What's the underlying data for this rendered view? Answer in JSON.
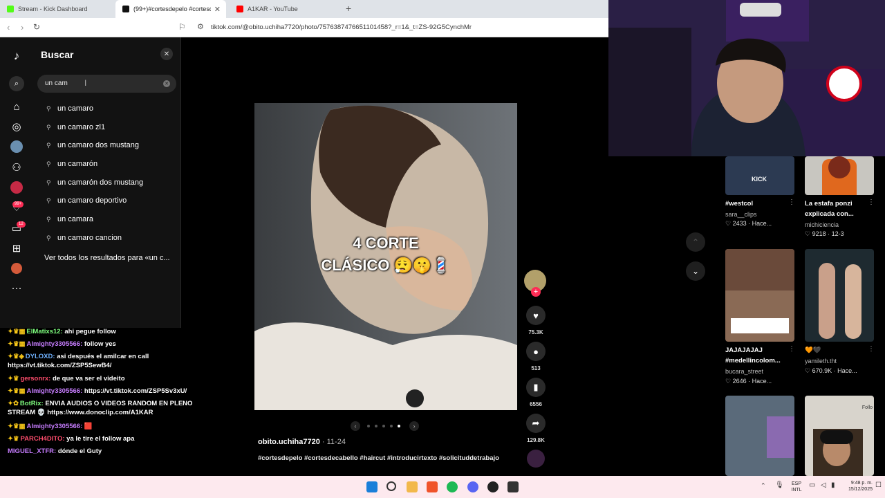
{
  "browser": {
    "tabs": [
      {
        "title": "Stream - Kick Dashboard"
      },
      {
        "title": "(99+)#cortesdepelo #cortesdec..."
      },
      {
        "title": "A1KAR - YouTube"
      }
    ],
    "url": "tiktok.com/@obito.uchiha7720/photo/7576387476651101458?_r=1&_t=ZS-92G5CynchMr"
  },
  "sidebar": {
    "rail_icons": [
      "tiktok-logo-icon",
      "search-icon",
      "home-icon",
      "explore-icon",
      "following-icon",
      "friends-icon",
      "live-icon",
      "activity-icon",
      "messages-icon",
      "upload-icon",
      "profile-icon",
      "more-icon"
    ],
    "badges": {
      "activity": "99+",
      "messages": "12"
    }
  },
  "search": {
    "title": "Buscar",
    "query": "un cam",
    "suggestions": [
      "un camaro",
      "un camaro zl1",
      "un camaro dos mustang",
      "un camarón",
      "un camarón dos mustang",
      "un camaro deportivo",
      "un camara",
      "un camaro cancion"
    ],
    "see_all": "Ver todos los resultados para «un c..."
  },
  "chat": [
    {
      "user": "ElMatixs12:",
      "color": "#7fff7f",
      "msg": "ahi pegue follow"
    },
    {
      "user": "Almighty3305566:",
      "color": "#c77dff",
      "msg": "follow yes"
    },
    {
      "user": "DYLOXD:",
      "color": "#6fb1ff",
      "msg": "asi después el amilcar en call",
      "cont": "https://vt.tiktok.com/ZSP5SewB4/"
    },
    {
      "user": "gersonrx:",
      "color": "#ff4d6d",
      "msg": "de que va ser el videito"
    },
    {
      "user": "Almighty3305566:",
      "color": "#c77dff",
      "msg": "https://vt.tiktok.com/ZSP5Sv3xU/"
    },
    {
      "user": "BotRix:",
      "color": "#7fff7f",
      "msg": "ENVIA AUDIOS O VIDEOS RANDOM EN PLENO",
      "cont": "STREAM 💀 https://www.donoclip.com/A1KAR"
    },
    {
      "user": "Almighty3305566:",
      "color": "#c77dff",
      "msg": "🟥"
    },
    {
      "user": "PARCH4DITO:",
      "color": "#ff4d6d",
      "msg": "ya le tire el follow apa"
    },
    {
      "user": "MIGUEL_XTFR:",
      "color": "#c77dff",
      "msg": "dónde el Guty"
    }
  ],
  "post": {
    "caption_line1": "4 CORTE",
    "caption_line2": "CLÁSICO 😮‍💨🤫💈",
    "author": "obito.uchiha7720",
    "date": " · 11-24",
    "hashtags": "#cortesdepelo #cortesdecabello #haircut #introducirtexto #solicituddetrabajo",
    "slides": 5,
    "current_slide": 5,
    "likes": "75.3K",
    "comments": "513",
    "saves": "6556",
    "shares": "129.8K"
  },
  "grid": [
    {
      "title": "#westcol",
      "title2": "",
      "user": "sara__clips",
      "stat": "2433 · Hace...",
      "thumb_label": "KICK"
    },
    {
      "title": "La estafa ponzi",
      "title2": "explicada con...",
      "user": "michiciencia",
      "stat": "9218 · 12-3",
      "thumb_label": ""
    },
    {
      "title": "JAJAJAJAJ",
      "title2": "#medellincolom...",
      "user": "bucara_street",
      "stat": "2646 · Hace...",
      "thumb_label": ""
    },
    {
      "title": "🧡🖤",
      "title2": "",
      "user": "yamileth.tht",
      "stat": "670.9K · Hace...",
      "thumb_label": ""
    },
    {
      "title": "",
      "title2": "",
      "user": "",
      "stat": "",
      "thumb_label": ""
    },
    {
      "title": "",
      "title2": "",
      "user": "",
      "stat": "",
      "thumb_label": "Follo"
    }
  ],
  "taskbar": {
    "lang1": "ESP",
    "lang2": "INTL",
    "time": "9:48 p. m.",
    "date": "15/12/2025"
  },
  "colors": {
    "accent": "#fe2c55",
    "bg": "#000000",
    "panel": "#121212"
  }
}
